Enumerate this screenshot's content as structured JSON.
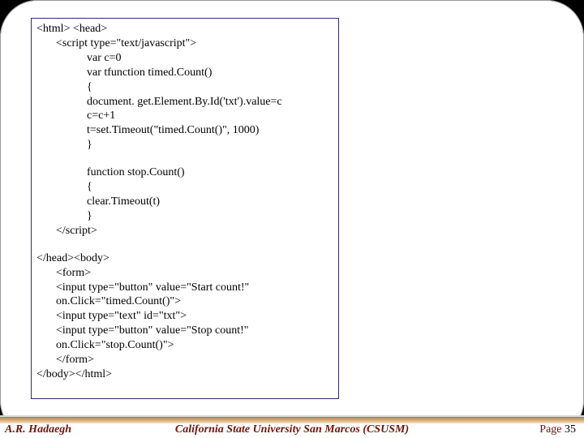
{
  "code": {
    "l1": "<html> <head>",
    "l2": "<script type=\"text/javascript\">",
    "l3": "var c=0",
    "l4": "var tfunction timed.Count()",
    "l5": "{",
    "l6": "document. get.Element.By.Id('txt').value=c",
    "l7": "c=c+1",
    "l8": "t=set.Timeout(\"timed.Count()\", 1000)",
    "l9": "}",
    "l10": "function stop.Count()",
    "l11": "{",
    "l12": "clear.Timeout(t)",
    "l13": "}",
    "l14": "</script>",
    "l15": "</head><body>",
    "l16": "<form>",
    "l17": "<input type=\"button\" value=\"Start count!\"",
    "l18": "on.Click=\"timed.Count()\">",
    "l19": "<input type=\"text\" id=\"txt\">",
    "l20": "<input type=\"button\" value=\"Stop count!\"",
    "l21": "on.Click=\"stop.Count()\">",
    "l22": "</form>",
    "l23": "</body></html>"
  },
  "footer": {
    "author": "A.R. Hadaegh",
    "university": "California State University San Marcos (CSUSM)",
    "page_label": "Page ",
    "page_number": "35"
  }
}
